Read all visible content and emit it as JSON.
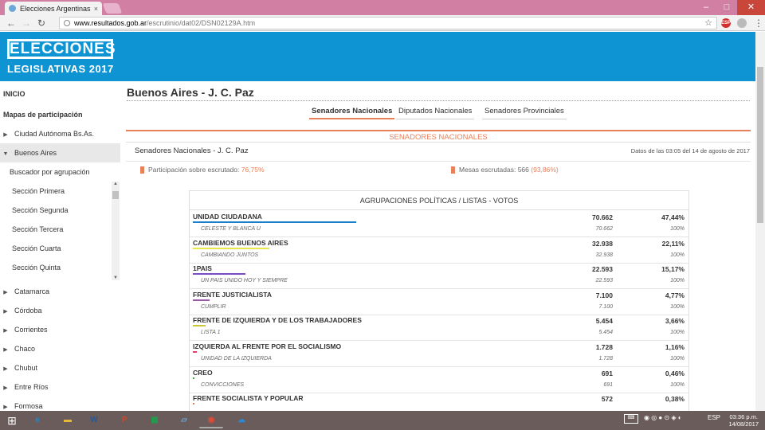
{
  "browser": {
    "tab_title": "Elecciones Argentinas de",
    "tab_close": "×",
    "url_host": "www.resultados.gob.ar",
    "url_path": "/escrutinio/dat02/DSN02129A.htm",
    "ext_label": "ESP",
    "nav": {
      "back": "←",
      "forward": "→",
      "reload": "↻",
      "star": "☆",
      "menu": "⋮"
    },
    "window": {
      "minimize": "–",
      "maximize": "□",
      "close": "✕"
    }
  },
  "header": {
    "logo_title": "ELECCIONES",
    "logo_subtitle": "LEGISLATIVAS 2017",
    "color": "#0e94d3"
  },
  "sidebar": {
    "inicio": "INICIO",
    "mapas": "Mapas de participación",
    "provinces_top": [
      {
        "label": "Ciudad Autónoma Bs.As.",
        "arrow": "▶",
        "active": false
      },
      {
        "label": "Buenos Aires",
        "arrow": "▼",
        "active": true
      }
    ],
    "sub_items": [
      "Buscador por agrupación",
      "Sección Primera",
      "Sección Segunda",
      "Sección Tercera",
      "Sección Cuarta",
      "Sección Quinta"
    ],
    "provinces_bottom": [
      {
        "label": "Catamarca",
        "arrow": "▶"
      },
      {
        "label": "Córdoba",
        "arrow": "▶"
      },
      {
        "label": "Corrientes",
        "arrow": "▶"
      },
      {
        "label": "Chaco",
        "arrow": "▶"
      },
      {
        "label": "Chubut",
        "arrow": "▶"
      },
      {
        "label": "Entre Ríos",
        "arrow": "▶"
      },
      {
        "label": "Formosa",
        "arrow": "▶"
      }
    ]
  },
  "main": {
    "title": "Buenos Aires - J. C. Paz",
    "tabs": [
      "Senadores Nacionales",
      "Diputados Nacionales",
      "Senadores Provinciales"
    ],
    "active_tab": 0,
    "section_title": "SENADORES NACIONALES",
    "section_subtitle": "Senadores Nacionales - J. C. Paz",
    "datos": "Datos de las 03:05 del 14 de agosto de 2017",
    "participacion_label": "Participación sobre escrutado:",
    "participacion_value": "76,75%",
    "mesas_label": "Mesas escrutadas: 566",
    "mesas_value": "(93,86%)",
    "accent": "#e8815a"
  },
  "table": {
    "header": "AGRUPACIONES POLÍTICAS / LISTAS - VOTOS",
    "rows": [
      {
        "party": "UNIDAD CIUDADANA",
        "votes": "70.662",
        "pct": "47,44%",
        "share": 0.4744,
        "color": "#1a7fc8",
        "lista": "CELESTE Y BLANCA U",
        "lvotes": "70.662",
        "lpct": "100%"
      },
      {
        "party": "CAMBIEMOS BUENOS AIRES",
        "votes": "32.938",
        "pct": "22,11%",
        "share": 0.2211,
        "color": "#e8e84a",
        "lista": "CAMBIANDO JUNTOS",
        "lvotes": "32.938",
        "lpct": "100%"
      },
      {
        "party": "1PAIS",
        "votes": "22.593",
        "pct": "15,17%",
        "share": 0.1517,
        "color": "#7b4cc2",
        "lista": "UN PAIS UNIDO HOY Y SIEMPRE",
        "lvotes": "22.593",
        "lpct": "100%"
      },
      {
        "party": "FRENTE JUSTICIALISTA",
        "votes": "7.100",
        "pct": "4,77%",
        "share": 0.0477,
        "color": "#9a5aa8",
        "lista": "CUMPLIR",
        "lvotes": "7.100",
        "lpct": "100%"
      },
      {
        "party": "FRENTE DE IZQUIERDA Y DE LOS TRABAJADORES",
        "votes": "5.454",
        "pct": "3,66%",
        "share": 0.0366,
        "color": "#c8c830",
        "lista": "LISTA 1",
        "lvotes": "5.454",
        "lpct": "100%"
      },
      {
        "party": "IZQUIERDA AL FRENTE POR EL SOCIALISMO",
        "votes": "1.728",
        "pct": "1,16%",
        "share": 0.0116,
        "color": "#e0406a",
        "lista": "UNIDAD DE LA IZQUIERDA",
        "lvotes": "1.728",
        "lpct": "100%"
      },
      {
        "party": "CREO",
        "votes": "691",
        "pct": "0,46%",
        "share": 0.0046,
        "color": "#3aaa3a",
        "lista": "CONVICCIONES",
        "lvotes": "691",
        "lpct": "100%"
      },
      {
        "party": "FRENTE SOCIALISTA Y POPULAR",
        "votes": "572",
        "pct": "0,38%",
        "share": 0.0038,
        "color": "#e8815a",
        "lista": "",
        "lvotes": "",
        "lpct": ""
      }
    ]
  },
  "taskbar": {
    "lang": "ESP",
    "time": "03:36 p.m.",
    "date": "14/08/2017",
    "apps": [
      {
        "name": "ie",
        "glyph": "e",
        "color": "#1e88d8"
      },
      {
        "name": "explorer",
        "glyph": "▬",
        "color": "#e8b83a"
      },
      {
        "name": "word",
        "glyph": "W",
        "color": "#2b5797"
      },
      {
        "name": "powerpoint",
        "glyph": "P",
        "color": "#d24726"
      },
      {
        "name": "store",
        "glyph": "▦",
        "color": "#1e9e4a"
      },
      {
        "name": "tablet",
        "glyph": "▱",
        "color": "#6aa8d8"
      },
      {
        "name": "chrome",
        "glyph": "◉",
        "color": "#dd4b39"
      },
      {
        "name": "onedrive",
        "glyph": "☁",
        "color": "#2a8ad8"
      }
    ]
  }
}
